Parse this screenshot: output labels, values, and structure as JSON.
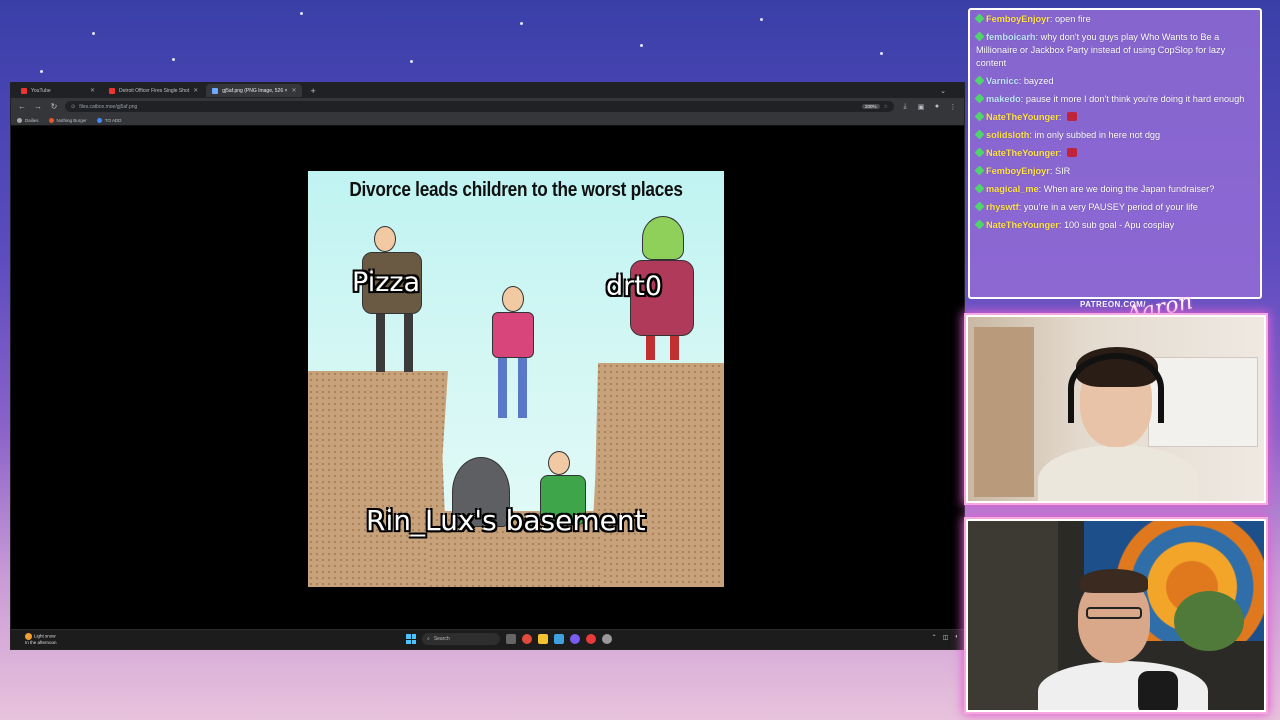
{
  "browser": {
    "tabs": [
      {
        "label": "YouTube",
        "active": false
      },
      {
        "label": "Detroit Officer Fires Single Shot",
        "active": false
      },
      {
        "label": "gj5af.png (PNG Image, 526 ×",
        "active": true
      }
    ],
    "new_tab": "+",
    "url": "files.catbox.moe/gj5af.png",
    "zoom": "200%",
    "bookmarks": [
      "Dailies",
      "Nothing Burger",
      "TO ADD"
    ]
  },
  "meme": {
    "title": "Divorce leads children to the worst places",
    "label_left": "Pizza",
    "label_right": "drt0",
    "label_bottom": "Rin_Lux's basement"
  },
  "taskbar": {
    "weather_line1": "Light snow",
    "weather_line2": "In the afternoon",
    "search_placeholder": "Search"
  },
  "chat": {
    "messages": [
      {
        "user": "FemboyEnjoyr",
        "text": "open fire",
        "color": "#ffe14d"
      },
      {
        "user": "femboicarh",
        "text": "why don't you guys play Who Wants to Be a Millionaire or Jackbox Party instead of using CopSlop for lazy content",
        "color": "#bfe4ff"
      },
      {
        "user": "Varnicc",
        "text": "bayzed",
        "color": "#bfe4ff"
      },
      {
        "user": "makedo",
        "text": "pause it more I don't think you're doing it hard enough",
        "color": "#bfe4ff"
      },
      {
        "user": "NateTheYounger",
        "text": "",
        "color": "#ffe14d"
      },
      {
        "user": "solidsloth",
        "text": "im only subbed in here not dgg",
        "color": "#ffe14d"
      },
      {
        "user": "NateTheYounger",
        "text": "",
        "color": "#ffe14d"
      },
      {
        "user": "FemboyEnjoyr",
        "text": "SIR",
        "color": "#ffe14d"
      },
      {
        "user": "magical_me",
        "text": "When are we doing the Japan fundraiser?",
        "color": "#ffe14d"
      },
      {
        "user": "rhyswtf",
        "text": "you're in a very PAUSEY period of your life",
        "color": "#ffe14d"
      },
      {
        "user": "NateTheYounger",
        "text": "100 sub goal - Apu cosplay",
        "color": "#ffe14d"
      }
    ]
  },
  "overlay": {
    "patreon": "PATREON.COM/"
  }
}
